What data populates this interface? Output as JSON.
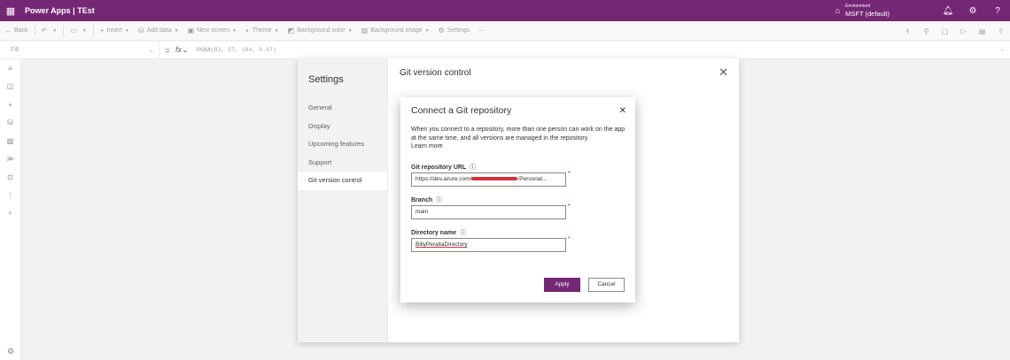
{
  "header": {
    "waffle_icon": "⋮⋮⋮",
    "title": "Power Apps | TEst",
    "environment_label": "Environment",
    "environment_name": "MSFT (default)"
  },
  "commandbar": {
    "back": "Back",
    "insert": "Insert",
    "add_data": "Add data",
    "new_screen": "New screen",
    "theme": "Theme",
    "background_color": "Background color",
    "background_image": "Background image",
    "settings": "Settings"
  },
  "formulabar": {
    "property": "Fill",
    "formula": "RGBA(93, 57, 184, 0.97)"
  },
  "settings": {
    "title": "Settings",
    "nav": [
      "General",
      "Display",
      "Upcoming features",
      "Support",
      "Git version control"
    ],
    "section_heading": "Git version control"
  },
  "dialog": {
    "title": "Connect a Git repository",
    "description": "When you connect to a repository, more than one person can work on the app at the same time, and all versions are managed in the repository.",
    "learn_more": "Learn more",
    "repo_label": "Git repository URL",
    "repo_value_start": "https://dev.azure.com/",
    "repo_value_end": "/Personal...",
    "branch_label": "Branch",
    "branch_value": "main",
    "directory_label": "Directory name",
    "directory_value": "BillyPeraltaDirectory",
    "required_marker": "*",
    "apply": "Apply",
    "cancel": "Cancel"
  },
  "colors": {
    "brand": "#742774",
    "required": "#a4262c"
  }
}
